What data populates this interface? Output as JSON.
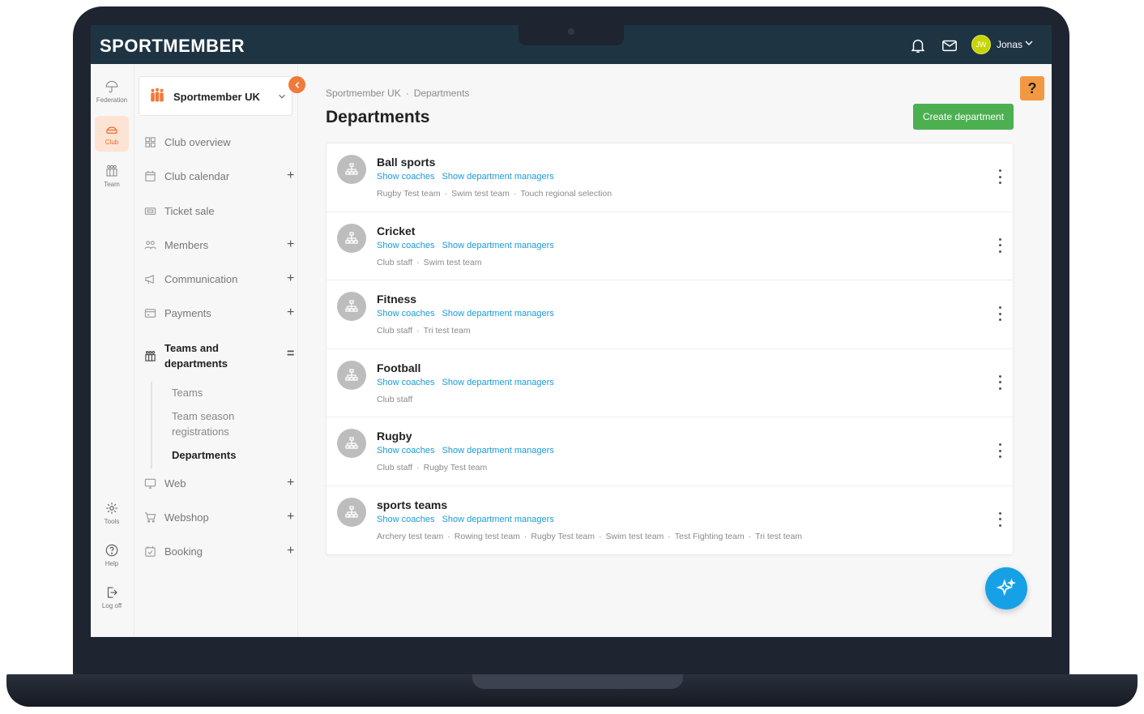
{
  "app": {
    "logo": "SPORTMEMBER",
    "user_initials": "JW",
    "user_name": "Jonas"
  },
  "rail": [
    {
      "label": "Federation",
      "icon": "umbrella-icon"
    },
    {
      "label": "Club",
      "icon": "club-icon"
    },
    {
      "label": "Team",
      "icon": "team-icon"
    },
    {
      "label": "Tools",
      "icon": "gear-icon"
    },
    {
      "label": "Help",
      "icon": "help-icon"
    },
    {
      "label": "Log off",
      "icon": "logout-icon"
    }
  ],
  "sidebar": {
    "club_name": "Sportmember UK",
    "items": [
      {
        "label": "Club overview"
      },
      {
        "label": "Club calendar",
        "expand": "+"
      },
      {
        "label": "Ticket sale"
      },
      {
        "label": "Members",
        "expand": "+"
      },
      {
        "label": "Communication",
        "expand": "+"
      },
      {
        "label": "Payments",
        "expand": "+"
      },
      {
        "label": "Teams and departments",
        "expand": "="
      },
      {
        "label": "Web",
        "expand": "+"
      },
      {
        "label": "Webshop",
        "expand": "+"
      },
      {
        "label": "Booking",
        "expand": "+"
      }
    ],
    "sub_items": [
      {
        "label": "Teams"
      },
      {
        "label": "Team season registrations"
      },
      {
        "label": "Departments"
      }
    ]
  },
  "main": {
    "breadcrumb": [
      "Sportmember UK",
      "Departments"
    ],
    "breadcrumb_sep": "·",
    "title": "Departments",
    "create_label": "Create department",
    "help_label": "?",
    "show_coaches": "Show coaches",
    "show_managers": "Show department managers",
    "departments": [
      {
        "name": "Ball sports",
        "teams": [
          "Rugby Test team",
          "Swim test team",
          "Touch regional selection"
        ]
      },
      {
        "name": "Cricket",
        "teams": [
          "Club staff",
          "Swim test team"
        ]
      },
      {
        "name": "Fitness",
        "teams": [
          "Club staff",
          "Tri test team"
        ]
      },
      {
        "name": "Football",
        "teams": [
          "Club staff"
        ]
      },
      {
        "name": "Rugby",
        "teams": [
          "Club staff",
          "Rugby Test team"
        ]
      },
      {
        "name": "sports teams",
        "teams": [
          "Archery test team",
          "Rowing test team",
          "Rugby Test team",
          "Swim test team",
          "Test Fighting team",
          "Tri test team"
        ]
      }
    ]
  },
  "colors": {
    "topbar": "#1e3443",
    "accent": "#f07a3a",
    "create": "#4caf50",
    "link": "#1a9ad6",
    "fab": "#16a1e6"
  }
}
